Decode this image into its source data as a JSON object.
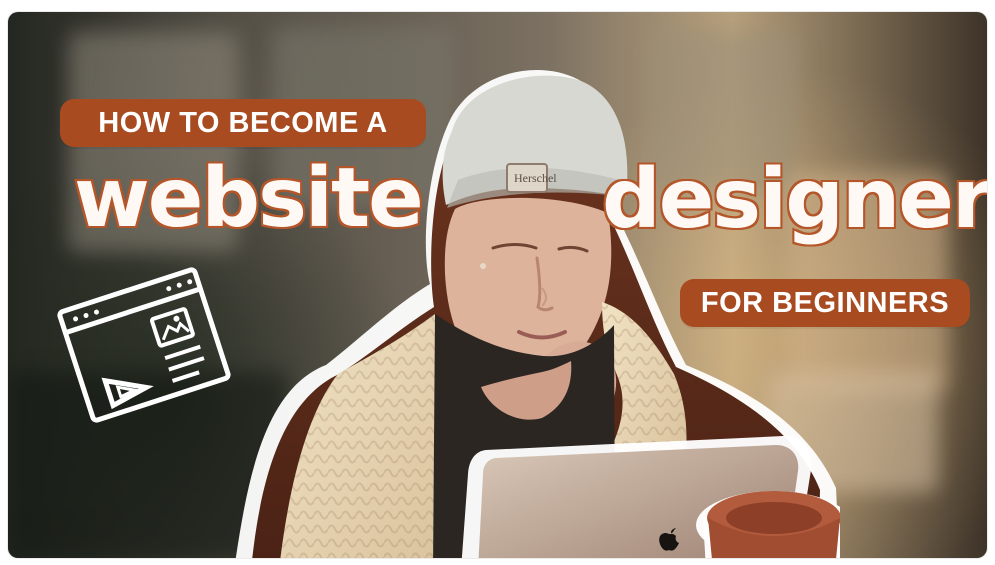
{
  "thumbnail": {
    "top_label": "HOW TO BECOME A",
    "left_word": "website",
    "right_word": "designer",
    "bottom_label": "FOR BEGINNERS",
    "accent_color": "#a84b20",
    "text_color": "#fff9f6",
    "icons": [
      "browser-window-icon",
      "image-icon",
      "triangle-ruler-icon",
      "apple-logo-icon"
    ]
  }
}
